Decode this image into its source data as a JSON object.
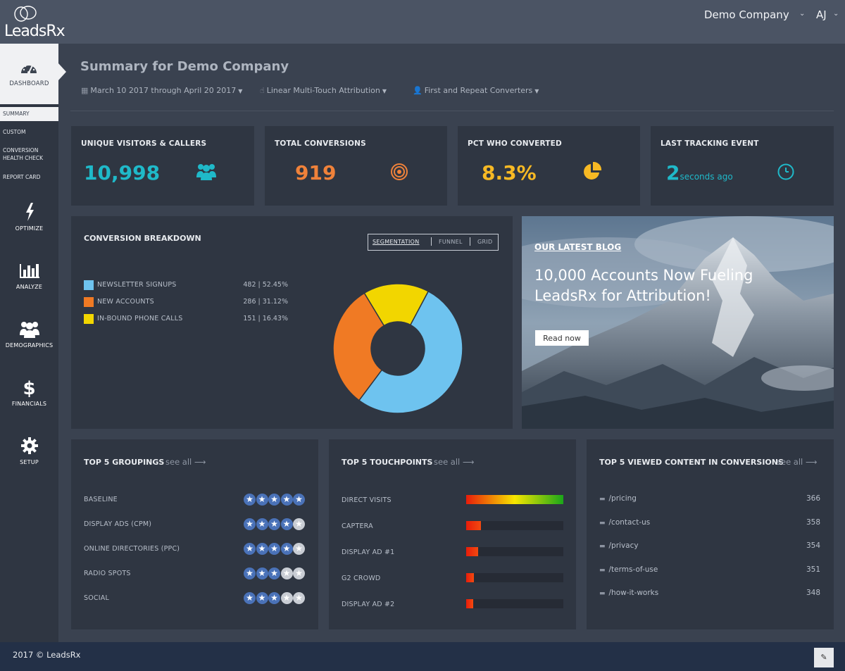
{
  "app": {
    "logo_text": "LeadsRx",
    "company": "Demo Company",
    "user_initials": "AJ"
  },
  "sidebar": {
    "dashboard_label": "DASHBOARD",
    "sub_items": [
      {
        "label": "SUMMARY",
        "active": true
      },
      {
        "label": "CUSTOM"
      },
      {
        "label": "CONVERSION HEALTH CHECK"
      },
      {
        "label": "REPORT CARD"
      }
    ],
    "nav": [
      {
        "label": "OPTIMIZE",
        "icon": "lightning-icon"
      },
      {
        "label": "ANALYZE",
        "icon": "bar-chart-icon"
      },
      {
        "label": "DEMOGRAPHICS",
        "icon": "users-icon"
      },
      {
        "label": "FINANCIALS",
        "icon": "dollar-icon"
      },
      {
        "label": "SETUP",
        "icon": "gear-icon"
      }
    ]
  },
  "header": {
    "title": "Summary for Demo Company",
    "date_range": "March 10 2017 through April 20 2017",
    "attribution": "Linear Multi-Touch Attribution",
    "converters": "First and Repeat Converters"
  },
  "kpis": [
    {
      "title": "UNIQUE VISITORS & CALLERS",
      "value": "10,998",
      "color": "#1fb9c9",
      "icon": "users-icon"
    },
    {
      "title": "TOTAL CONVERSIONS",
      "value": "919",
      "color": "#f0823a",
      "icon": "target-icon"
    },
    {
      "title": "PCT WHO CONVERTED",
      "value": "8.3%",
      "color": "#f7b924",
      "icon": "pie-icon"
    },
    {
      "title": "LAST TRACKING EVENT",
      "value": "2",
      "suffix": "seconds ago",
      "color": "#1fb9c9",
      "icon": "clock-icon"
    }
  ],
  "breakdown": {
    "title": "CONVERSION BREAKDOWN",
    "tabs": [
      "SEGMENTATION",
      "FUNNEL",
      "GRID"
    ],
    "active_tab": "SEGMENTATION"
  },
  "chart_data": {
    "type": "pie",
    "donut": true,
    "categories": [
      "NEWSLETTER SIGNUPS",
      "NEW ACCOUNTS",
      "IN-BOUND PHONE CALLS"
    ],
    "values": [
      482,
      286,
      151
    ],
    "percent": [
      52.45,
      31.12,
      16.43
    ],
    "display": [
      "482 | 52.45%",
      "286 | 31.12%",
      "151 | 16.43%"
    ],
    "colors": [
      "#6ec3ef",
      "#f07a24",
      "#f2d600"
    ]
  },
  "blog": {
    "kicker": "OUR LATEST BLOG",
    "headline": "10,000 Accounts Now Fueling LeadsRx for Attribution!",
    "button": "Read now"
  },
  "groupings": {
    "title": "TOP 5 GROUPINGS",
    "see_all": "see all ⟶",
    "rows": [
      {
        "label": "BASELINE",
        "stars": 5
      },
      {
        "label": "DISPLAY ADS (CPM)",
        "stars": 4
      },
      {
        "label": "ONLINE DIRECTORIES (PPC)",
        "stars": 4
      },
      {
        "label": "RADIO SPOTS",
        "stars": 3
      },
      {
        "label": "SOCIAL",
        "stars": 3
      }
    ]
  },
  "touchpoints": {
    "title": "TOP 5 TOUCHPOINTS",
    "see_all": "see all ⟶",
    "rows": [
      {
        "label": "DIRECT VISITS",
        "level": 1.0
      },
      {
        "label": "CAPTERA",
        "level": 0.15
      },
      {
        "label": "DISPLAY AD #1",
        "level": 0.12
      },
      {
        "label": "G2 CROWD",
        "level": 0.08
      },
      {
        "label": "DISPLAY AD #2",
        "level": 0.07
      }
    ]
  },
  "content": {
    "title": "TOP 5 VIEWED CONTENT IN CONVERSIONS",
    "see_all": "see all ⟶",
    "rows": [
      {
        "path": "/pricing",
        "count": "366"
      },
      {
        "path": "/contact-us",
        "count": "358"
      },
      {
        "path": "/privacy",
        "count": "354"
      },
      {
        "path": "/terms-of-use",
        "count": "351"
      },
      {
        "path": "/how-it-works",
        "count": "348"
      }
    ]
  },
  "footer": {
    "text": "2017 © LeadsRx"
  }
}
